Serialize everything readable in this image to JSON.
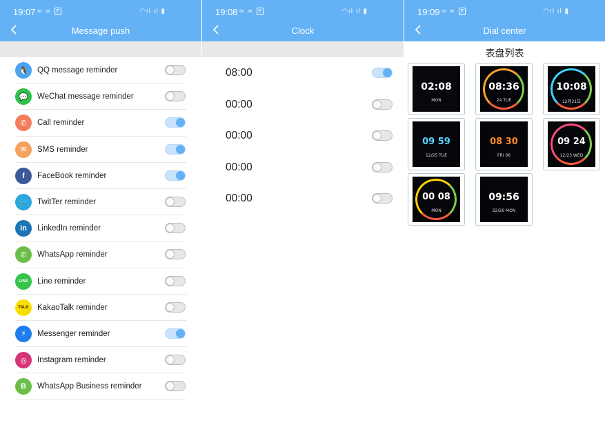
{
  "panels": {
    "message_push": {
      "status_time": "19:07",
      "title": "Message push",
      "items": [
        {
          "label": "QQ message reminder",
          "icon": "qq-icon",
          "color": "#4ba4f0",
          "on": false
        },
        {
          "label": "WeChat message reminder",
          "icon": "wechat-icon",
          "color": "#2fc24a",
          "on": false
        },
        {
          "label": "Call reminder",
          "icon": "phone-icon",
          "color": "#f37d5c",
          "on": true
        },
        {
          "label": "SMS reminder",
          "icon": "sms-icon",
          "color": "#f5a25f",
          "on": true
        },
        {
          "label": "FaceBook reminder",
          "icon": "facebook-icon",
          "color": "#3b5998",
          "on": true
        },
        {
          "label": "TwitTer reminder",
          "icon": "twitter-icon",
          "color": "#2ca7e0",
          "on": false
        },
        {
          "label": "LinkedIn reminder",
          "icon": "linkedin-icon",
          "color": "#1c74b3",
          "on": false
        },
        {
          "label": "WhatsApp reminder",
          "icon": "whatsapp-icon",
          "color": "#6bbf48",
          "on": false
        },
        {
          "label": "Line reminder",
          "icon": "line-icon",
          "color": "#34c44a",
          "on": false
        },
        {
          "label": "KakaoTalk reminder",
          "icon": "kakaotalk-icon",
          "color": "#f9e000",
          "on": false
        },
        {
          "label": "Messenger reminder",
          "icon": "messenger-icon",
          "color": "#1e7ef0",
          "on": true
        },
        {
          "label": "Instagram reminder",
          "icon": "instagram-icon",
          "color": "#d8347a",
          "on": false
        },
        {
          "label": "WhatsApp Business reminder",
          "icon": "whatsapp-business-icon",
          "color": "#6bbf48",
          "on": false
        }
      ]
    },
    "clock": {
      "status_time": "19:08",
      "title": "Clock",
      "alarms": [
        {
          "time": "08:00",
          "on": true
        },
        {
          "time": "00:00",
          "on": false
        },
        {
          "time": "00:00",
          "on": false
        },
        {
          "time": "00:00",
          "on": false
        },
        {
          "time": "00:00",
          "on": false
        }
      ]
    },
    "dial_center": {
      "status_time": "19:09",
      "title": "Dial center",
      "heading": "表盘列表",
      "dials": [
        {
          "time": "02:08",
          "sub": "MON"
        },
        {
          "time": "08:36",
          "sub": "24 TUE"
        },
        {
          "time": "10:08",
          "sub": "12月21日"
        },
        {
          "time": "09 59",
          "sub": "12/25 TUE"
        },
        {
          "time": "08 30",
          "sub": "FRI 06"
        },
        {
          "time": "09 24",
          "sub": "12/23 WED"
        },
        {
          "time": "00 08",
          "sub": "MON"
        },
        {
          "time": "09:56",
          "sub": "22/26 MON"
        }
      ]
    }
  },
  "colors": {
    "accent": "#64b2f5",
    "toggle_on": "#64b2f5"
  }
}
